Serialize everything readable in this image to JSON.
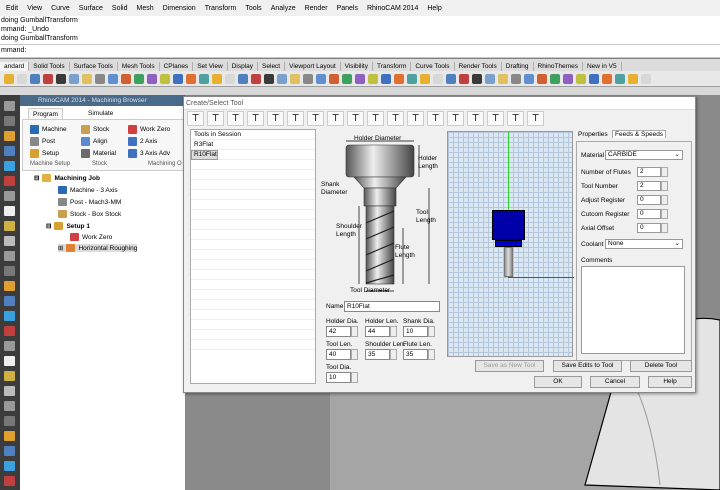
{
  "menu": [
    "Edit",
    "View",
    "Curve",
    "Surface",
    "Solid",
    "Mesh",
    "Dimension",
    "Transform",
    "Tools",
    "Analyze",
    "Render",
    "Panels",
    "RhinoCAM 2014",
    "Help"
  ],
  "command_history": [
    "doing GumballTransform",
    "mmand: _Undo",
    "doing GumballTransform"
  ],
  "command_prompt": "mmand:",
  "toolbar_tabs": [
    "andard",
    "Solid Tools",
    "Surface Tools",
    "Mesh Tools",
    "CPlanes",
    "Set View",
    "Display",
    "Select",
    "Viewport Layout",
    "Visibility",
    "Transform",
    "Curve Tools",
    "Render Tools",
    "Drafting",
    "RhinoThemes",
    "New in V5"
  ],
  "rhinocam": {
    "title": "RhinoCAM 2014 - Machining Browser",
    "tabs": [
      "Program",
      "Simulate"
    ],
    "buttons": {
      "machine": "Machine",
      "post": "Post",
      "setup": "Setup",
      "stock": "Stock",
      "align": "Align",
      "material": "Material",
      "work_zero": "Work Zero",
      "axis2": "2 Axis",
      "axis3": "3 Axis Adv"
    },
    "groups": [
      "Machine Setup",
      "Stock",
      "Machining O"
    ],
    "tree": {
      "job": "Machining Job",
      "machine": "Machine - 3 Axis",
      "post": "Post - Mach3-MM",
      "stock": "Stock - Box Stock",
      "setup": "Setup 1",
      "work_zero": "Work Zero",
      "op": "Horizontal Roughing"
    }
  },
  "dialog": {
    "title": "Create/Select Tool",
    "tools_header": "Tools in Session",
    "tools": [
      "R3Flat",
      "R10Flat"
    ],
    "diagram": {
      "holder_diameter": "Holder Diameter",
      "holder": "Holder",
      "length": "Length",
      "shank": "Shank",
      "diameter": "Diameter",
      "shoulder": "Shoulder",
      "tool": "Tool",
      "flute": "Flute",
      "tool_diameter": "Tool Diameter"
    },
    "name_label": "Name",
    "name_value": "R10Flat",
    "fields": {
      "holder_dia": {
        "label": "Holder Dia.",
        "value": "42"
      },
      "holder_len": {
        "label": "Holder Len.",
        "value": "44"
      },
      "shank_dia": {
        "label": "Shank Dia.",
        "value": "10"
      },
      "tool_len": {
        "label": "Tool Len.",
        "value": "40"
      },
      "shoulder_len": {
        "label": "Shoulder Len.",
        "value": "35"
      },
      "flute_len": {
        "label": "Flute Len.",
        "value": "35"
      },
      "tool_dia": {
        "label": "Tool Dia.",
        "value": "10"
      }
    },
    "prop_tabs": [
      "Properties",
      "Feeds & Speeds"
    ],
    "props": {
      "material_label": "Material",
      "material_value": "CARBIDE",
      "flutes_label": "Number of Flutes",
      "flutes_value": "2",
      "tool_number_label": "Tool Number",
      "tool_number_value": "2",
      "adjust_label": "Adjust Register",
      "adjust_value": "0",
      "cutcom_label": "Cutcom Register",
      "cutcom_value": "0",
      "axial_label": "Axial Offset",
      "axial_value": "0",
      "coolant_label": "Coolant",
      "coolant_value": "None",
      "comments_label": "Comments"
    },
    "buttons": {
      "save_new": "Save as New Tool",
      "save_edits": "Save Edits to Tool",
      "delete": "Delete Tool",
      "ok": "OK",
      "cancel": "Cancel",
      "help": "Help"
    }
  },
  "colors": {
    "tool_holder": "#0000aa",
    "grid_bg": "#dbe7f3",
    "axis_green": "#2bd32b",
    "axis_red": "#e01818"
  }
}
